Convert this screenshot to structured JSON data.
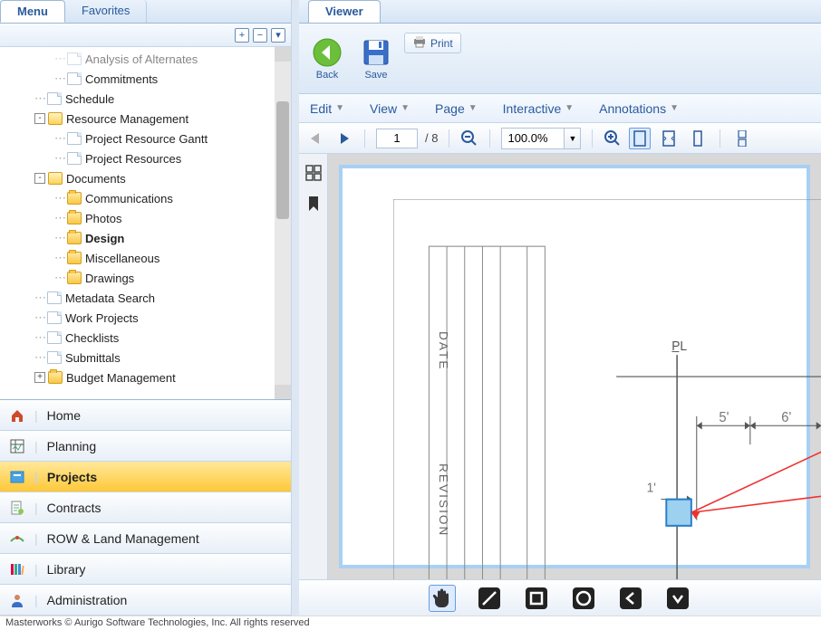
{
  "left": {
    "tabs": {
      "menu": "Menu",
      "favorites": "Favorites"
    },
    "tree": [
      {
        "depth": 2,
        "icon": "file",
        "label": "Analysis of Alternates",
        "cut": true
      },
      {
        "depth": 2,
        "icon": "file",
        "label": "Commitments"
      },
      {
        "depth": 1,
        "icon": "file",
        "label": "Schedule"
      },
      {
        "depth": 1,
        "icon": "folder-open",
        "label": "Resource Management",
        "toggle": "-"
      },
      {
        "depth": 2,
        "icon": "file",
        "label": "Project Resource Gantt"
      },
      {
        "depth": 2,
        "icon": "file",
        "label": "Project Resources"
      },
      {
        "depth": 1,
        "icon": "folder-open",
        "label": "Documents",
        "toggle": "-"
      },
      {
        "depth": 2,
        "icon": "folder",
        "label": "Communications"
      },
      {
        "depth": 2,
        "icon": "folder",
        "label": "Photos"
      },
      {
        "depth": 2,
        "icon": "folder",
        "label": "Design",
        "bold": true
      },
      {
        "depth": 2,
        "icon": "folder",
        "label": "Miscellaneous"
      },
      {
        "depth": 2,
        "icon": "folder",
        "label": "Drawings"
      },
      {
        "depth": 1,
        "icon": "file",
        "label": "Metadata Search"
      },
      {
        "depth": 1,
        "icon": "file",
        "label": "Work Projects"
      },
      {
        "depth": 1,
        "icon": "file",
        "label": "Checklists"
      },
      {
        "depth": 1,
        "icon": "file",
        "label": "Submittals"
      },
      {
        "depth": 1,
        "icon": "folder",
        "label": "Budget Management",
        "toggle": "+",
        "cutbottom": true
      }
    ],
    "nav": [
      {
        "label": "Home",
        "icon": "home"
      },
      {
        "label": "Planning",
        "icon": "planning"
      },
      {
        "label": "Projects",
        "icon": "projects",
        "active": true
      },
      {
        "label": "Contracts",
        "icon": "contracts"
      },
      {
        "label": "ROW & Land Management",
        "icon": "row"
      },
      {
        "label": "Library",
        "icon": "library"
      },
      {
        "label": "Administration",
        "icon": "admin"
      }
    ]
  },
  "right": {
    "tab": "Viewer",
    "ribbon": {
      "back": "Back",
      "save": "Save",
      "print": "Print"
    },
    "menus": [
      "Edit",
      "View",
      "Page",
      "Interactive",
      "Annotations"
    ],
    "toolbar": {
      "page_current": "1",
      "page_total": "/ 8",
      "zoom": "100.0%"
    },
    "drawing": {
      "labels": {
        "date": "DATE",
        "revision": "REVISION",
        "pl": "P̲L"
      },
      "dims": {
        "d5": "5'",
        "d6": "6'",
        "d1": "1'"
      }
    }
  },
  "footer": "Masterworks © Aurigo Software Technologies, Inc. All rights reserved"
}
